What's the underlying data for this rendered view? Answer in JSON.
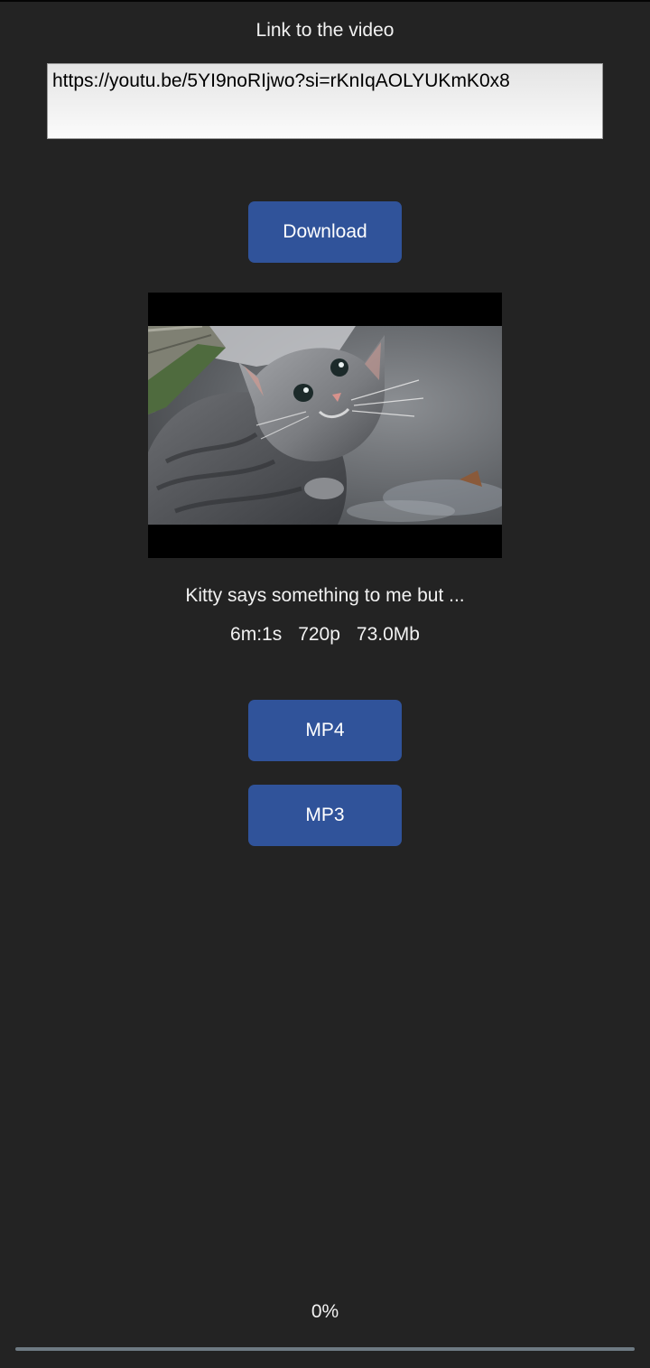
{
  "header": {
    "link_label": "Link to the video"
  },
  "url_input": {
    "value": "https://youtu.be/5YI9noRIjwo?si=rKnIqAOLYUKmK0x8"
  },
  "buttons": {
    "download": "Download",
    "mp4": "MP4",
    "mp3": "MP3"
  },
  "video": {
    "thumbnail_icon": "cat-photo",
    "title": "Kitty says something to me but ...",
    "duration": "6m:1s",
    "resolution": "720p",
    "size": "73.0Mb"
  },
  "progress": {
    "text": "0%",
    "fraction": 0
  },
  "colors": {
    "background": "#232323",
    "button": "#30539a",
    "progress_track": "#6e7a83"
  }
}
